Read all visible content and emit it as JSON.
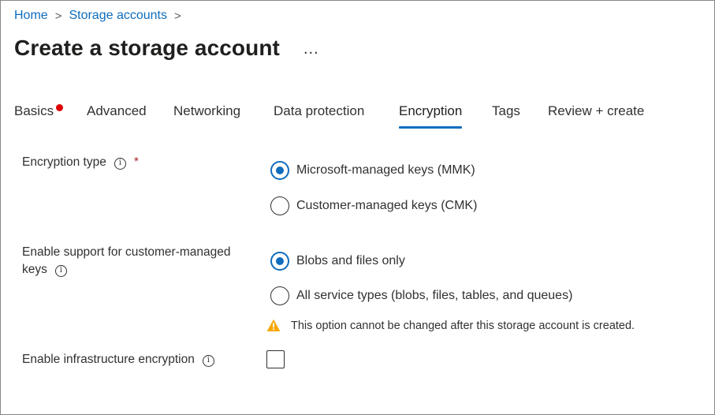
{
  "breadcrumb": {
    "home": "Home",
    "storage_accounts": "Storage accounts",
    "separator": ">"
  },
  "page": {
    "title": "Create a storage account",
    "more": "..."
  },
  "tabs": [
    {
      "label": "Basics",
      "active": false,
      "has_error": true
    },
    {
      "label": "Advanced",
      "active": false
    },
    {
      "label": "Networking",
      "active": false
    },
    {
      "label": "Data protection",
      "active": false
    },
    {
      "label": "Encryption",
      "active": true
    },
    {
      "label": "Tags",
      "active": false
    },
    {
      "label": "Review + create",
      "active": false
    }
  ],
  "encryption_type": {
    "label": "Encryption type",
    "required_mark": "*",
    "options": [
      {
        "label": "Microsoft-managed keys (MMK)",
        "selected": true
      },
      {
        "label": "Customer-managed keys (CMK)",
        "selected": false
      }
    ]
  },
  "cmk_support": {
    "label_line1": "Enable support for customer-managed",
    "label_line2": "keys",
    "options": [
      {
        "label": "Blobs and files only",
        "selected": true
      },
      {
        "label": "All service types (blobs, files, tables, and queues)",
        "selected": false
      }
    ],
    "warning": "This option cannot be changed after this storage account is created."
  },
  "infrastructure_encryption": {
    "label": "Enable infrastructure encryption",
    "checked": false
  },
  "colors": {
    "accent": "#0f6cbd",
    "error_dot": "#e00000",
    "warning": "#f7a600"
  },
  "icons": {
    "info": "i"
  }
}
